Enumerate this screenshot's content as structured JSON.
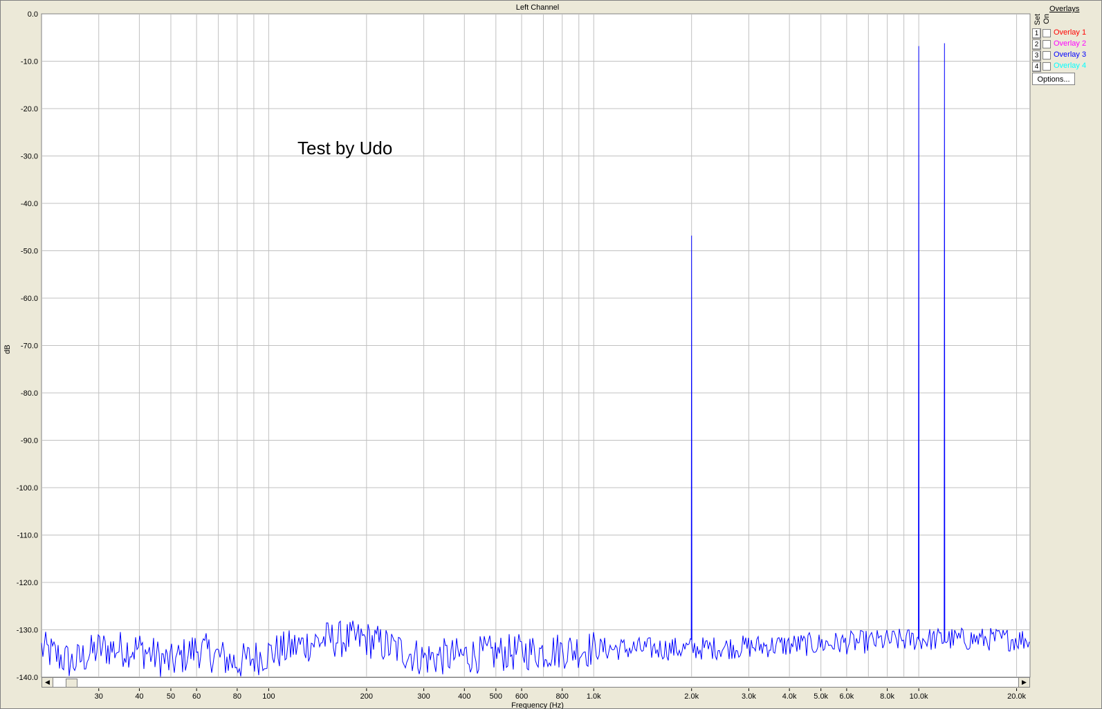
{
  "chart_data": {
    "type": "line",
    "title": "Left Channel",
    "xlabel": "Frequency (Hz)",
    "ylabel": "dB",
    "xscale": "log",
    "xlim": [
      20,
      22000
    ],
    "ylim": [
      -140,
      0
    ],
    "grid": true,
    "annotation": "Test by Udo",
    "line_color": "#0000ff",
    "y_ticks": [
      0,
      -10,
      -20,
      -30,
      -40,
      -50,
      -60,
      -70,
      -80,
      -90,
      -100,
      -110,
      -120,
      -130,
      -140
    ],
    "y_tick_labels": [
      "0.0",
      "-10.0",
      "-20.0",
      "-30.0",
      "-40.0",
      "-50.0",
      "-60.0",
      "-70.0",
      "-80.0",
      "-90.0",
      "-100.0",
      "-110.0",
      "-120.0",
      "-130.0",
      "-140.0"
    ],
    "x_ticks": [
      30,
      40,
      50,
      60,
      80,
      100,
      200,
      300,
      400,
      500,
      600,
      800,
      1000,
      2000,
      3000,
      4000,
      5000,
      6000,
      8000,
      10000,
      20000
    ],
    "x_tick_labels": [
      "30",
      "40",
      "50",
      "60",
      "80",
      "100",
      "200",
      "300",
      "400",
      "500",
      "600",
      "800",
      "1.0k",
      "2.0k",
      "3.0k",
      "4.0k",
      "5.0k",
      "6.0k",
      "8.0k",
      "10.0k",
      "20.0k"
    ],
    "noise_floor": {
      "x": [
        20,
        25,
        30,
        40,
        50,
        60,
        80,
        100,
        150,
        200,
        300,
        500,
        1000,
        2000,
        5000,
        10000,
        22000
      ],
      "y": [
        -134,
        -137,
        -134,
        -134,
        -137,
        -134,
        -137,
        -135,
        -132,
        -132,
        -136,
        -135,
        -134,
        -134,
        -133,
        -132,
        -132
      ]
    },
    "peaks": [
      {
        "x": 2000,
        "y": -46.8
      },
      {
        "x": 10000,
        "y": -6.8
      },
      {
        "x": 12000,
        "y": -6.2
      }
    ]
  },
  "overlays": {
    "header": "Overlays",
    "set_label": "Set",
    "on_label": "On",
    "items": [
      {
        "num": "1",
        "name": "Overlay 1",
        "color": "#ff0000"
      },
      {
        "num": "2",
        "name": "Overlay 2",
        "color": "#ff00ff"
      },
      {
        "num": "3",
        "name": "Overlay 3",
        "color": "#0000ff"
      },
      {
        "num": "4",
        "name": "Overlay 4",
        "color": "#00ffff"
      }
    ],
    "options_label": "Options..."
  }
}
